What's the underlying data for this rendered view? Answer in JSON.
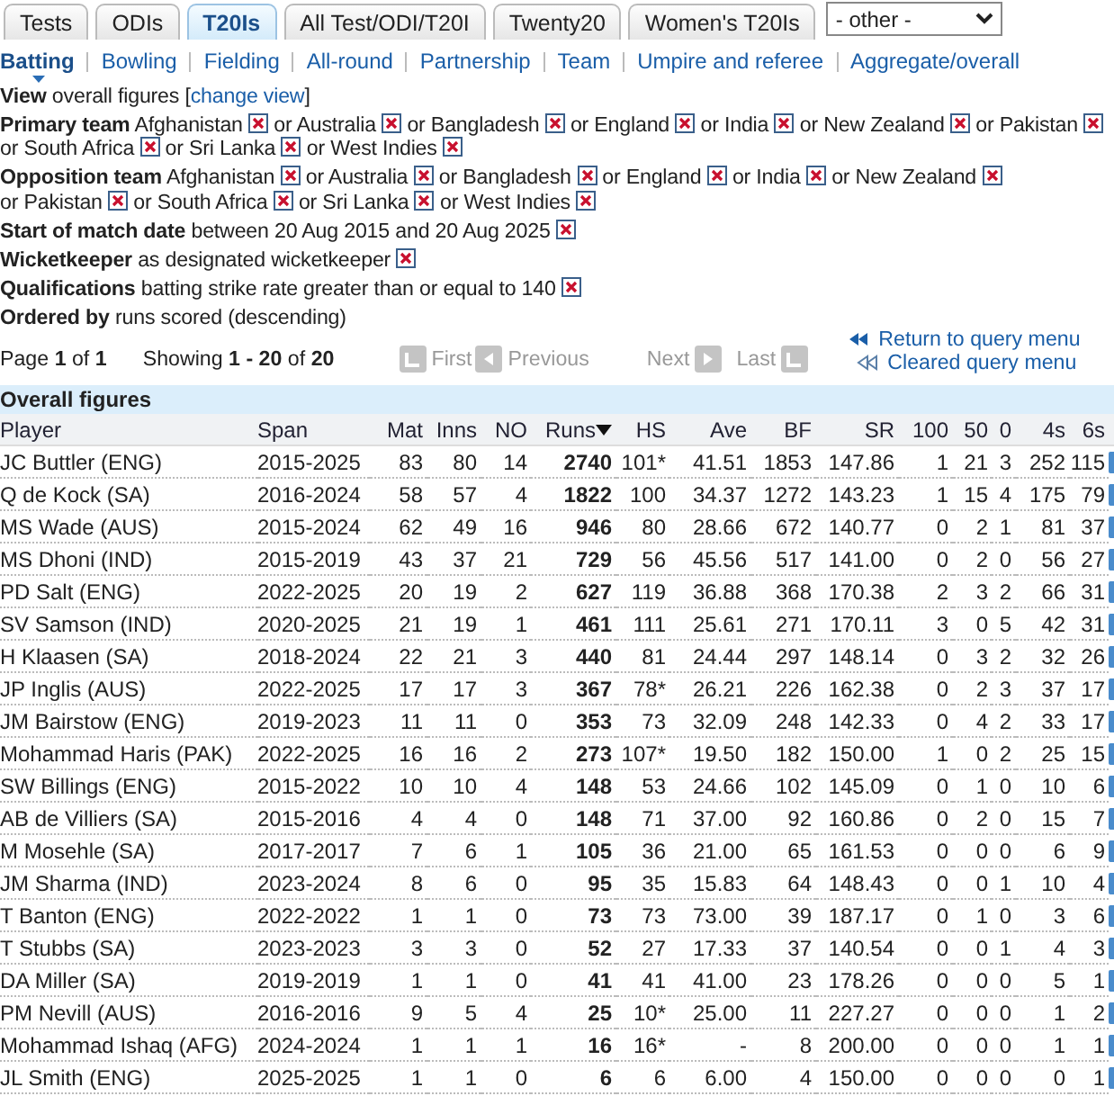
{
  "tabs": [
    {
      "label": "Tests",
      "selected": false
    },
    {
      "label": "ODIs",
      "selected": false
    },
    {
      "label": "T20Is",
      "selected": true
    },
    {
      "label": "All Test/ODI/T20I",
      "selected": false
    },
    {
      "label": "Twenty20",
      "selected": false
    },
    {
      "label": "Women's T20Is",
      "selected": false
    }
  ],
  "dropdown": {
    "value": "- other -"
  },
  "subnav": [
    {
      "label": "Batting",
      "selected": true
    },
    {
      "label": "Bowling",
      "selected": false
    },
    {
      "label": "Fielding",
      "selected": false
    },
    {
      "label": "All-round",
      "selected": false
    },
    {
      "label": "Partnership",
      "selected": false
    },
    {
      "label": "Team",
      "selected": false
    },
    {
      "label": "Umpire and referee",
      "selected": false
    },
    {
      "label": "Aggregate/overall",
      "selected": false
    }
  ],
  "view": {
    "before": "**View** overall figures [",
    "link": "change view",
    "after": "]"
  },
  "filters": [
    {
      "label": "Primary team",
      "values": [
        {
          "text": "Afghanistan",
          "removable": true
        },
        {
          "text": "or Australia",
          "removable": true
        },
        {
          "text": "or Bangladesh",
          "removable": true
        },
        {
          "text": "or England",
          "removable": true
        },
        {
          "text": "or India",
          "removable": true
        },
        {
          "text": "or New Zealand",
          "removable": true
        },
        {
          "text": "or Pakistan",
          "removable": true
        },
        {
          "text": "or South Africa",
          "removable": true
        },
        {
          "text": "or Sri Lanka",
          "removable": true
        },
        {
          "text": "or West Indies",
          "removable": true
        }
      ]
    },
    {
      "label": "Opposition team",
      "values": [
        {
          "text": "Afghanistan",
          "removable": true
        },
        {
          "text": "or Australia",
          "removable": true
        },
        {
          "text": "or Bangladesh",
          "removable": true
        },
        {
          "text": "or England",
          "removable": true
        },
        {
          "text": "or India",
          "removable": true
        },
        {
          "text": "or New Zealand",
          "removable": true
        },
        {
          "text": "or Pakistan",
          "removable": true
        },
        {
          "text": "or South Africa",
          "removable": true
        },
        {
          "text": "or Sri Lanka",
          "removable": true
        },
        {
          "text": "or West Indies",
          "removable": true
        }
      ]
    },
    {
      "label": "Start of match date",
      "values": [
        {
          "text": "between 20 Aug 2015 and 20 Aug 2025",
          "removable": true
        }
      ]
    },
    {
      "label": "Wicketkeeper",
      "values": [
        {
          "text": "as designated wicketkeeper",
          "removable": true
        }
      ]
    },
    {
      "label": "Qualifications",
      "values": [
        {
          "text": "batting strike rate greater than or equal to 140",
          "removable": true
        }
      ]
    },
    {
      "label": "Ordered by",
      "values": [
        {
          "text": "runs scored (descending)",
          "removable": false
        }
      ]
    }
  ],
  "pager": {
    "page": "Page **1** of **1**",
    "showing": "Showing **1 - 20** of **20**",
    "buttons": [
      {
        "label": "First",
        "kind": "first",
        "disabled": true
      },
      {
        "label": "Previous",
        "kind": "previous",
        "disabled": true
      },
      {
        "label": "Next",
        "kind": "next",
        "disabled": true
      },
      {
        "label": "Last",
        "kind": "last",
        "disabled": true
      }
    ],
    "links": [
      {
        "label": "Return to query menu",
        "kind": "return"
      },
      {
        "label": "Cleared query menu",
        "kind": "cleared"
      }
    ]
  },
  "table": {
    "title": "Overall figures",
    "columns": [
      {
        "label": "Player",
        "sorted": false,
        "bold": false
      },
      {
        "label": "Span",
        "sorted": false,
        "bold": false
      },
      {
        "label": "Mat",
        "sorted": false,
        "bold": false
      },
      {
        "label": "Inns",
        "sorted": false,
        "bold": false
      },
      {
        "label": "NO",
        "sorted": false,
        "bold": false
      },
      {
        "label": "Runs",
        "sorted": true,
        "bold": true
      },
      {
        "label": "HS",
        "sorted": false,
        "bold": false
      },
      {
        "label": "Ave",
        "sorted": false,
        "bold": false
      },
      {
        "label": "BF",
        "sorted": false,
        "bold": false
      },
      {
        "label": "SR",
        "sorted": false,
        "bold": false
      },
      {
        "label": "100",
        "sorted": false,
        "bold": false
      },
      {
        "label": "50",
        "sorted": false,
        "bold": false
      },
      {
        "label": "0",
        "sorted": false,
        "bold": false
      },
      {
        "label": "4s",
        "sorted": false,
        "bold": false
      },
      {
        "label": "6s",
        "sorted": false,
        "bold": false
      }
    ],
    "rows": [
      [
        "JC Buttler (ENG)",
        "2015-2025",
        "83",
        "80",
        "14",
        "2740",
        "101*",
        "41.51",
        "1853",
        "147.86",
        "1",
        "21",
        "3",
        "252",
        "115"
      ],
      [
        "Q de Kock (SA)",
        "2016-2024",
        "58",
        "57",
        "4",
        "1822",
        "100",
        "34.37",
        "1272",
        "143.23",
        "1",
        "15",
        "4",
        "175",
        "79"
      ],
      [
        "MS Wade (AUS)",
        "2015-2024",
        "62",
        "49",
        "16",
        "946",
        "80",
        "28.66",
        "672",
        "140.77",
        "0",
        "2",
        "1",
        "81",
        "37"
      ],
      [
        "MS Dhoni (IND)",
        "2015-2019",
        "43",
        "37",
        "21",
        "729",
        "56",
        "45.56",
        "517",
        "141.00",
        "0",
        "2",
        "0",
        "56",
        "27"
      ],
      [
        "PD Salt (ENG)",
        "2022-2025",
        "20",
        "19",
        "2",
        "627",
        "119",
        "36.88",
        "368",
        "170.38",
        "2",
        "3",
        "2",
        "66",
        "31"
      ],
      [
        "SV Samson (IND)",
        "2020-2025",
        "21",
        "19",
        "1",
        "461",
        "111",
        "25.61",
        "271",
        "170.11",
        "3",
        "0",
        "5",
        "42",
        "31"
      ],
      [
        "H Klaasen (SA)",
        "2018-2024",
        "22",
        "21",
        "3",
        "440",
        "81",
        "24.44",
        "297",
        "148.14",
        "0",
        "3",
        "2",
        "32",
        "26"
      ],
      [
        "JP Inglis (AUS)",
        "2022-2025",
        "17",
        "17",
        "3",
        "367",
        "78*",
        "26.21",
        "226",
        "162.38",
        "0",
        "2",
        "3",
        "37",
        "17"
      ],
      [
        "JM Bairstow (ENG)",
        "2019-2023",
        "11",
        "11",
        "0",
        "353",
        "73",
        "32.09",
        "248",
        "142.33",
        "0",
        "4",
        "2",
        "33",
        "17"
      ],
      [
        "Mohammad Haris (PAK)",
        "2022-2025",
        "16",
        "16",
        "2",
        "273",
        "107*",
        "19.50",
        "182",
        "150.00",
        "1",
        "0",
        "2",
        "25",
        "15"
      ],
      [
        "SW Billings (ENG)",
        "2015-2022",
        "10",
        "10",
        "4",
        "148",
        "53",
        "24.66",
        "102",
        "145.09",
        "0",
        "1",
        "0",
        "10",
        "6"
      ],
      [
        "AB de Villiers (SA)",
        "2015-2016",
        "4",
        "4",
        "0",
        "148",
        "71",
        "37.00",
        "92",
        "160.86",
        "0",
        "2",
        "0",
        "15",
        "7"
      ],
      [
        "M Mosehle (SA)",
        "2017-2017",
        "7",
        "6",
        "1",
        "105",
        "36",
        "21.00",
        "65",
        "161.53",
        "0",
        "0",
        "0",
        "6",
        "9"
      ],
      [
        "JM Sharma (IND)",
        "2023-2024",
        "8",
        "6",
        "0",
        "95",
        "35",
        "15.83",
        "64",
        "148.43",
        "0",
        "0",
        "1",
        "10",
        "4"
      ],
      [
        "T Banton (ENG)",
        "2022-2022",
        "1",
        "1",
        "0",
        "73",
        "73",
        "73.00",
        "39",
        "187.17",
        "0",
        "1",
        "0",
        "3",
        "6"
      ],
      [
        "T Stubbs (SA)",
        "2023-2023",
        "3",
        "3",
        "0",
        "52",
        "27",
        "17.33",
        "37",
        "140.54",
        "0",
        "0",
        "1",
        "4",
        "3"
      ],
      [
        "DA Miller (SA)",
        "2019-2019",
        "1",
        "1",
        "0",
        "41",
        "41",
        "41.00",
        "23",
        "178.26",
        "0",
        "0",
        "0",
        "5",
        "1"
      ],
      [
        "PM Nevill (AUS)",
        "2016-2016",
        "9",
        "5",
        "4",
        "25",
        "10*",
        "25.00",
        "11",
        "227.27",
        "0",
        "0",
        "0",
        "1",
        "2"
      ],
      [
        "Mohammad Ishaq (AFG)",
        "2024-2024",
        "1",
        "1",
        "1",
        "16",
        "16*",
        "-",
        "8",
        "200.00",
        "0",
        "0",
        "0",
        "1",
        "1"
      ],
      [
        "JL Smith (ENG)",
        "2025-2025",
        "1",
        "1",
        "0",
        "6",
        "6",
        "6.00",
        "4",
        "150.00",
        "0",
        "0",
        "0",
        "0",
        "1"
      ]
    ]
  }
}
